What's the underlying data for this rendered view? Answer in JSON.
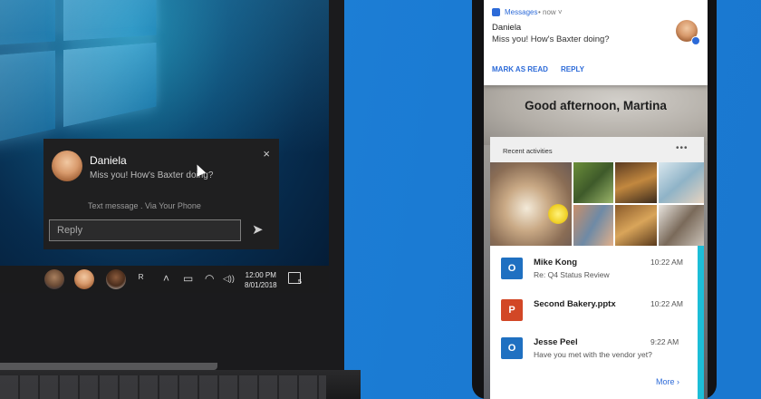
{
  "laptop": {
    "toast": {
      "sender": "Daniela",
      "message": "Miss you! How's Baxter doing?",
      "source": "Text message . Via Your Phone",
      "reply_placeholder": "Reply",
      "close_icon": "×",
      "send_icon": "➤"
    },
    "taskbar": {
      "people_icon": "ᴿ",
      "chevron_icon": "˄",
      "battery_icon": "▭",
      "wifi_icon": "◠",
      "volume_icon": "◁))",
      "time": "12:00 PM",
      "date": "8/01/2018",
      "notification_count": "5"
    }
  },
  "phone": {
    "notification": {
      "app": "Messages",
      "time": "• now ˅",
      "sender": "Daniela",
      "message": "Miss you! How's Baxter doing?",
      "actions": [
        "MARK AS READ",
        "REPLY"
      ]
    },
    "greeting": "Good afternoon, Martina",
    "recent": {
      "title": "Recent activities",
      "more_icon": "•••",
      "items": [
        {
          "icon": "O",
          "icon_color": "#1f70c1",
          "name": "Mike Kong",
          "sub": "Re: Q4 Status Review",
          "time": "10:22 AM"
        },
        {
          "icon": "P",
          "icon_color": "#d24726",
          "name": "Second Bakery.pptx",
          "sub": "",
          "time": "10:22 AM"
        },
        {
          "icon": "O",
          "icon_color": "#1f70c1",
          "name": "Jesse Peel",
          "sub": "Have you met with the vendor yet?",
          "time": "9:22 AM"
        }
      ],
      "more_label": "More ›"
    }
  }
}
